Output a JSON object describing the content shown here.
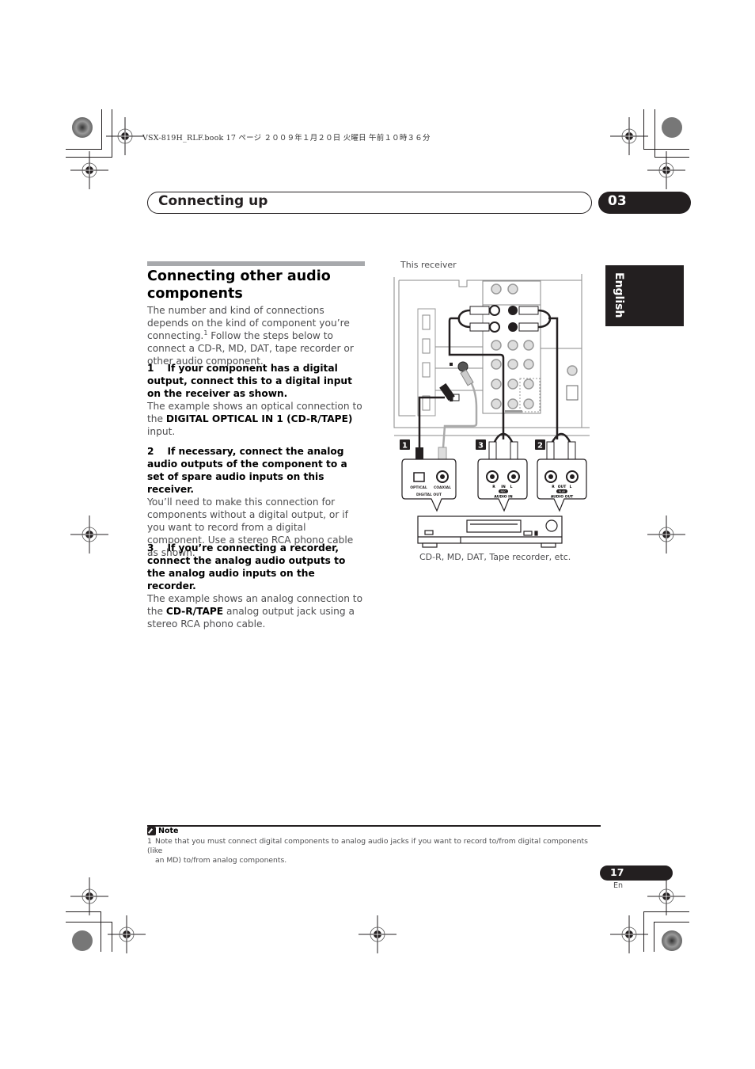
{
  "print_header": "VSX-819H_RLF.book  17 ページ  ２００９年１月２０日  火曜日  午前１０時３６分",
  "chapter": {
    "title": "Connecting up",
    "number": "03"
  },
  "language_tab": "English",
  "section": {
    "title": "Connecting other audio components",
    "intro": {
      "text_a": "The number and kind of connections depends on the kind of component you’re connecting.",
      "footnote_ref": "1",
      "text_b": " Follow the steps below to connect a CD-R, MD, DAT, tape recorder or other audio component."
    },
    "steps": [
      {
        "number": "1",
        "heading": "If your component has a digital output, connect this to a digital input on the receiver as shown.",
        "body_a": "The example shows an optical connection to the ",
        "body_bold": "DIGITAL OPTICAL IN 1 (CD-R/TAPE)",
        "body_b": " input."
      },
      {
        "number": "2",
        "heading": "If necessary, connect the analog audio outputs of the component to a set of spare audio inputs on this receiver.",
        "body_a": "You’ll need to make this connection for components without a digital output, or if you want to record from a digital component. Use a stereo RCA phono cable as shown.",
        "body_bold": "",
        "body_b": ""
      },
      {
        "number": "3",
        "heading": "If you’re connecting a recorder, connect the analog audio outputs to the analog audio inputs on the recorder.",
        "body_a": "The example shows an analog connection to the ",
        "body_bold": "CD-R/TAPE",
        "body_b": " analog output jack using a stereo RCA phono cable."
      }
    ]
  },
  "diagram": {
    "caption_top": "This receiver",
    "caption_bottom": "CD-R, MD, DAT, Tape recorder, etc.",
    "callouts": [
      "1",
      "3",
      "2"
    ],
    "panel_digital": {
      "left_label": "OPTICAL",
      "right_label": "COAXIAL",
      "group_label": "DIGITAL OUT"
    },
    "panel_audio_in": {
      "r": "R",
      "l": "L",
      "mode": "IN",
      "badge": "REC",
      "group_label": "AUDIO IN"
    },
    "panel_audio_out": {
      "r": "R",
      "l": "L",
      "mode": "OUT",
      "badge": "PLAY",
      "group_label": "AUDIO OUT"
    }
  },
  "note": {
    "heading": "Note",
    "items": [
      {
        "number": "1",
        "line1": "Note that you must connect digital components to analog audio jacks if you want to record to/from digital components (like",
        "line2": "an MD) to/from analog components."
      }
    ]
  },
  "footer": {
    "page_number": "17",
    "language": "En"
  }
}
